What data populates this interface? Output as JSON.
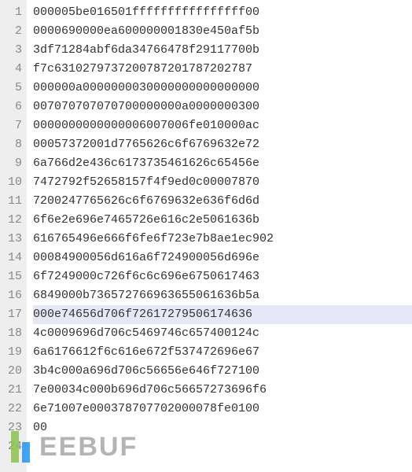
{
  "editor": {
    "highlight_line": 17,
    "lines": [
      "000005be016501ffffffffffffffff00",
      "0000690000ea600000001830e450af5b",
      "3df71284abf6da34766478f29117700b",
      "f7c6310279737200787201787202787",
      "000000a0000000030000000000000000",
      "007070707070700000000a0000000300",
      "0000000000000006007006fe010000ac",
      "00057372001d7765626c6f6769632e72",
      "6a766d2e436c6173735461626c65456e",
      "7472792f52658157f4f9ed0c00007870",
      "7200247765626c6f6769632e636f6d6d",
      "6f6e2e696e7465726e616c2e5061636b",
      "616765496e666f6fe6f723e7b8ae1ec902",
      "00084900056d616a6f724900056d696e",
      "6f7249000c726f6c6c696e6750617463",
      "6849000b736572766963655061636b5a",
      "000e74656d706f72617279506174636",
      "4c0009696d706c5469746c657400124c",
      "6a6176612f6c616e672f537472696e67",
      "3b4c000a696d706c56656e646f727100",
      "7e00034c000b696d706c56657273696f6",
      "6e71007e000378707702000078fe0100",
      "00",
      ""
    ]
  },
  "watermark": {
    "text": "EEBUF"
  }
}
